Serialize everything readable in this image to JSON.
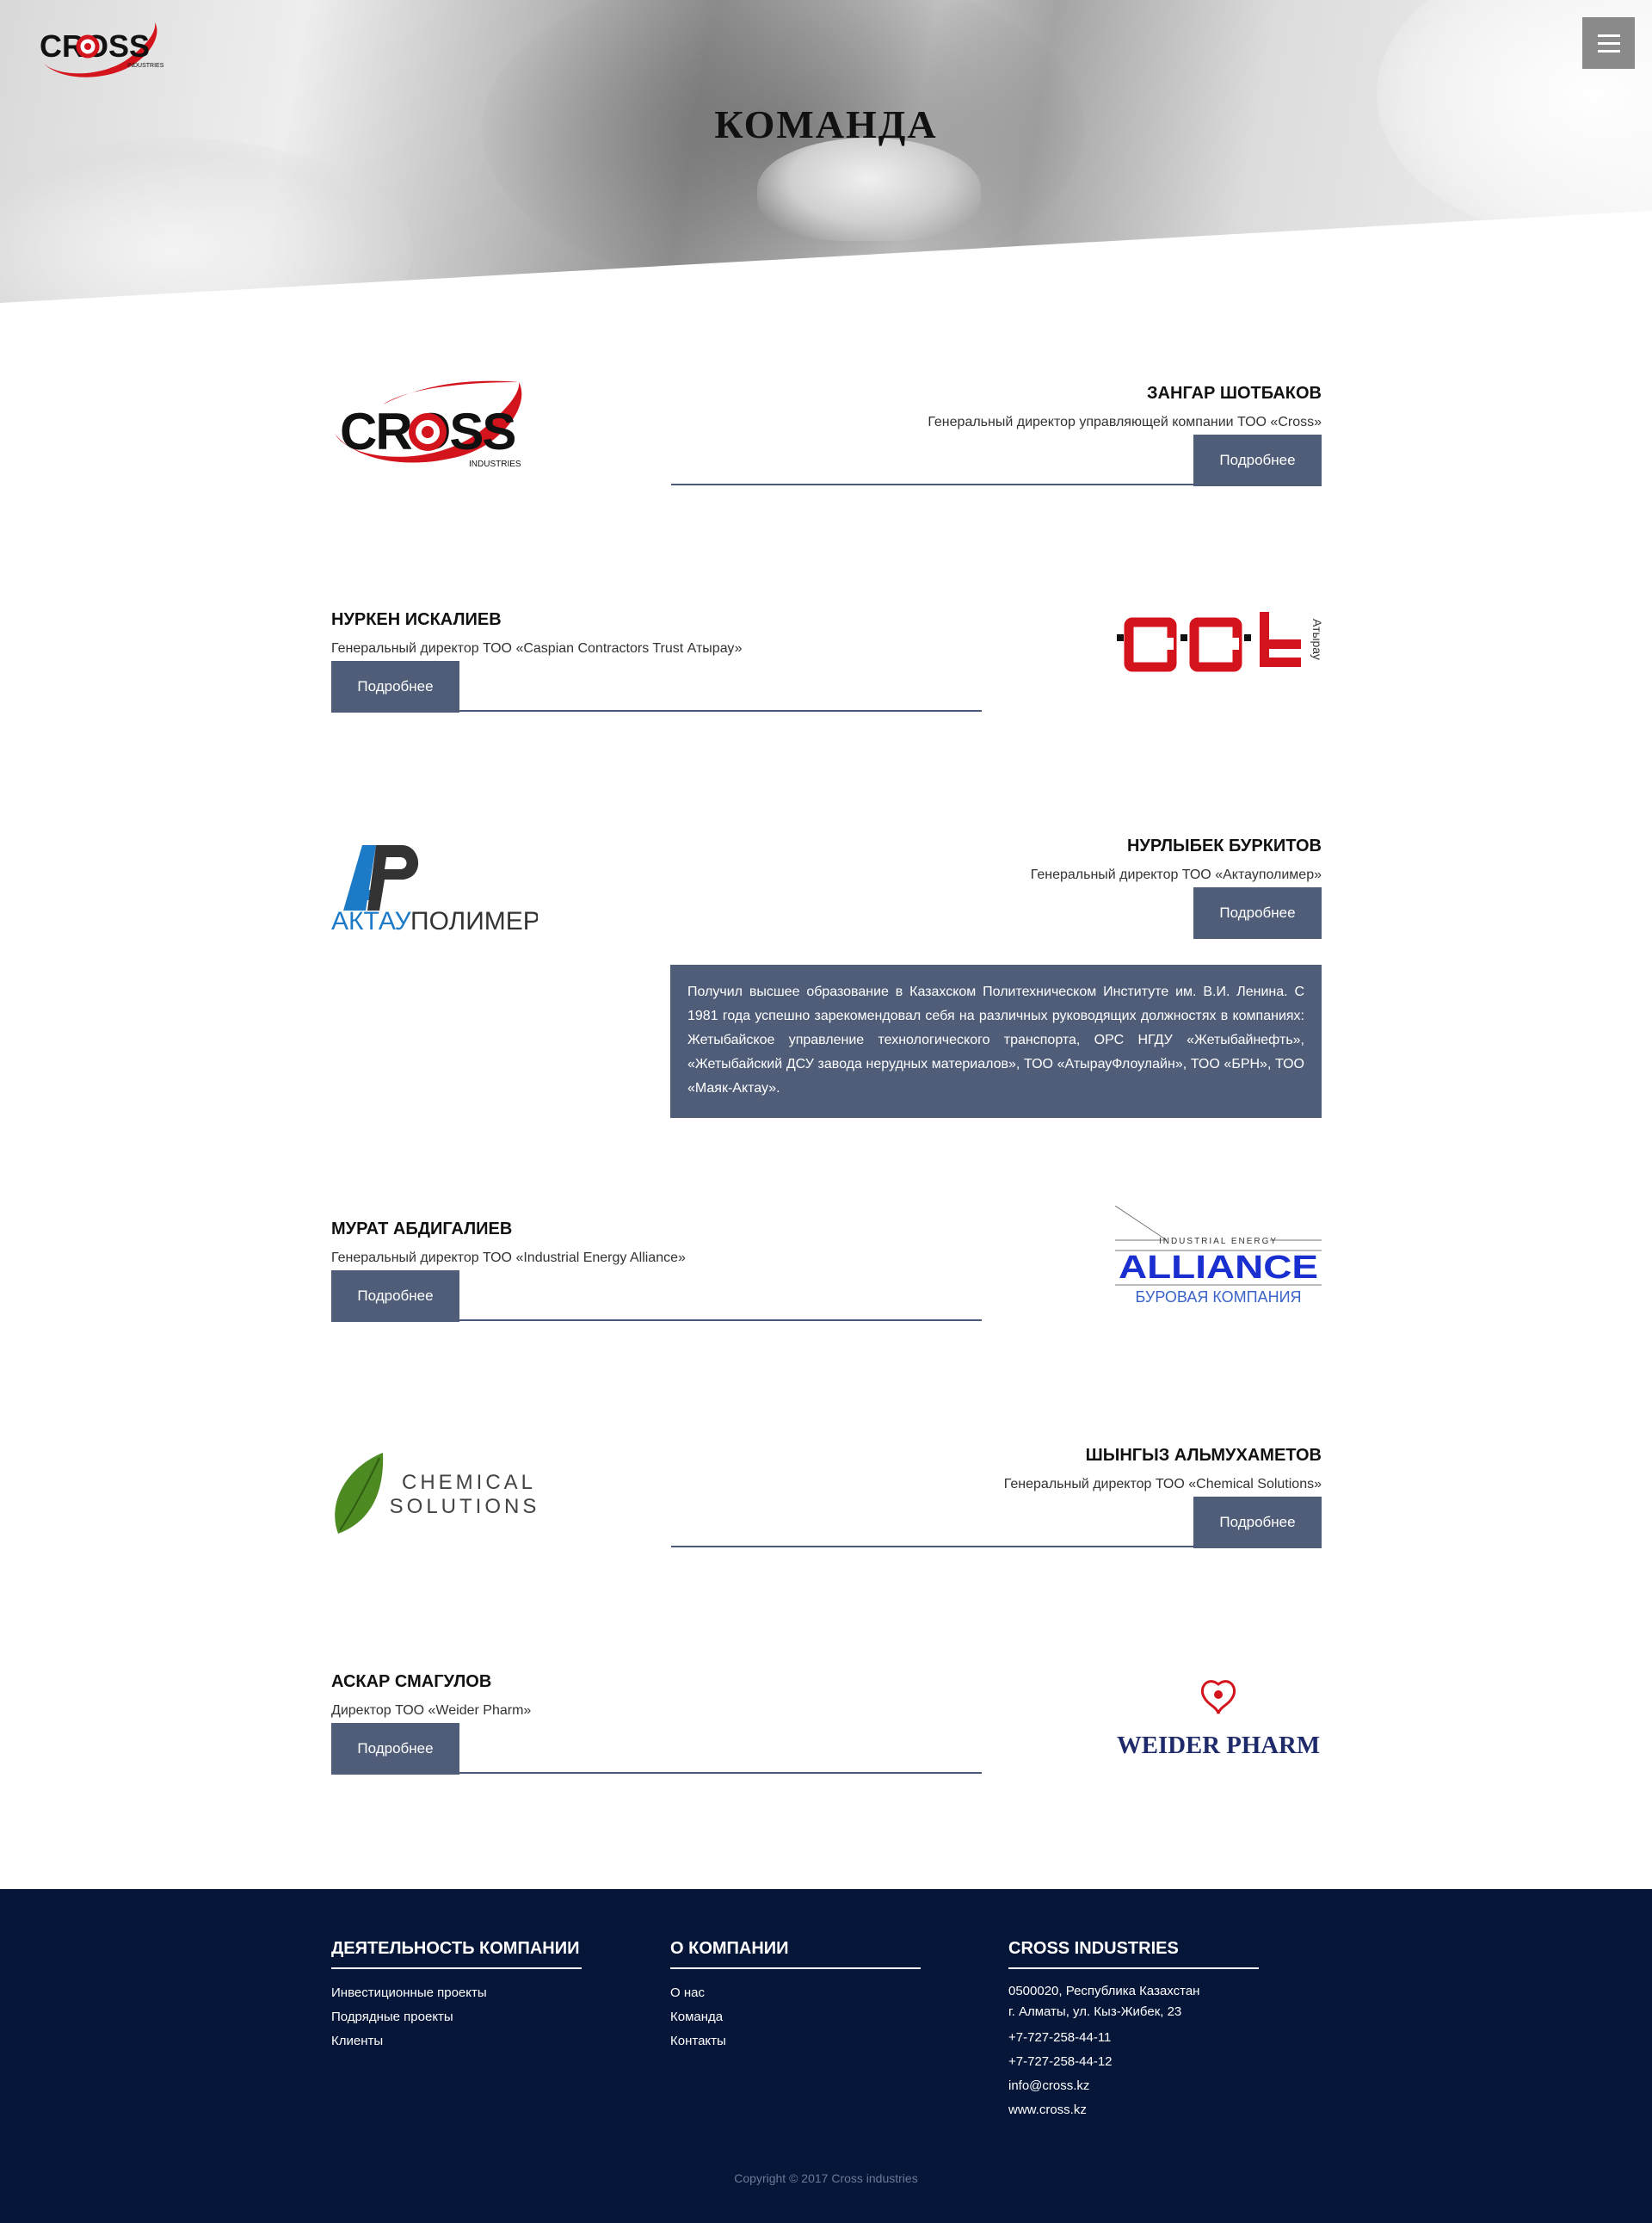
{
  "header": {
    "page_title": "КОМАНДА",
    "logo_text": "CROSS",
    "logo_subtext": "INDUSTRIES",
    "menu_icon": "hamburger-icon"
  },
  "team": [
    {
      "name": "ЗАНГАР ШОТБАКОВ",
      "role": "Генеральный директор управляющей компании ТОО «Cross»",
      "button": "Подробнее",
      "logo": {
        "text": "CROSS",
        "subtext": "INDUSTRIES"
      }
    },
    {
      "name": "НУРКЕН ИСКАЛИЕВ",
      "role": "Генеральный директор ТОО «Caspian Contractors Trust Атырау»",
      "button": "Подробнее",
      "logo": {
        "text": "CCt",
        "subtext": "Атырау"
      }
    },
    {
      "name": "НУРЛЫБЕК БУРКИТОВ",
      "role": "Генеральный директор ТОО «Актауполимер»",
      "button": "Подробнее",
      "logo": {
        "text_blue": "АКТАУ",
        "text_dark": "ПОЛИМЕР",
        "mark": "AP"
      },
      "bio": "Получил высшее образование в Казахском Политехническом Институте им. В.И. Ленина. С 1981 года успешно зарекомендовал себя на различных руководящих должностях в компаниях: Жетыбайское управление технологического транспорта, ОРС НГДУ «Жетыбайнефть», «Жетыбайский ДСУ завода нерудных материалов», ТОО «АтырауФлоулайн», ТОО «БРН», ТОО «Маяк-Актау»."
    },
    {
      "name": "МУРАТ АБДИГАЛИЕВ",
      "role": "Генеральный директор ТОО «Industrial Energy Alliance»",
      "button": "Подробнее",
      "logo": {
        "top": "INDUSTRIAL ENERGY",
        "main": "ALLIANCE",
        "bottom": "БУРОВАЯ КОМПАНИЯ"
      }
    },
    {
      "name": "ШЫНГЫЗ АЛЬМУХАМЕТОВ",
      "role": "Генеральный директор ТОО «Chemical Solutions»",
      "button": "Подробнее",
      "logo": {
        "line1": "CHEMICAL",
        "line2": "SOLUTIONS"
      }
    },
    {
      "name": "АСКАР СМАГУЛОВ",
      "role": "Директор ТОО «Weider Pharm»",
      "button": "Подробнее",
      "logo": {
        "text": "WEIDER PHARM"
      }
    }
  ],
  "footer": {
    "col1": {
      "title": "ДЕЯТЕЛЬНОСТЬ КОМПАНИИ",
      "links": [
        "Инвестиционные проекты",
        "Подрядные проекты",
        "Клиенты"
      ]
    },
    "col2": {
      "title": "О КОМПАНИИ",
      "links": [
        "О нас",
        "Команда",
        "Контакты"
      ]
    },
    "col3": {
      "title": "CROSS INDUSTRIES",
      "address1": "0500020, Республика Казахстан",
      "address2": "г. Алматы, ул. Кыз-Жибек, 23",
      "phone1": "+7-727-258-44-11",
      "phone2": "+7-727-258-44-12",
      "email": "info@cross.kz",
      "site": "www.cross.kz"
    },
    "copyright": "Copyright © 2017 Cross industries"
  },
  "colors": {
    "button_bg": "#4f5d78",
    "footer_bg": "#061638",
    "logo_red": "#d4141c",
    "aktau_blue": "#1c7ac6",
    "alliance_blue": "#1a2fd0",
    "weider_navy": "#1f2a6b",
    "leaf_green": "#4e8a22"
  }
}
